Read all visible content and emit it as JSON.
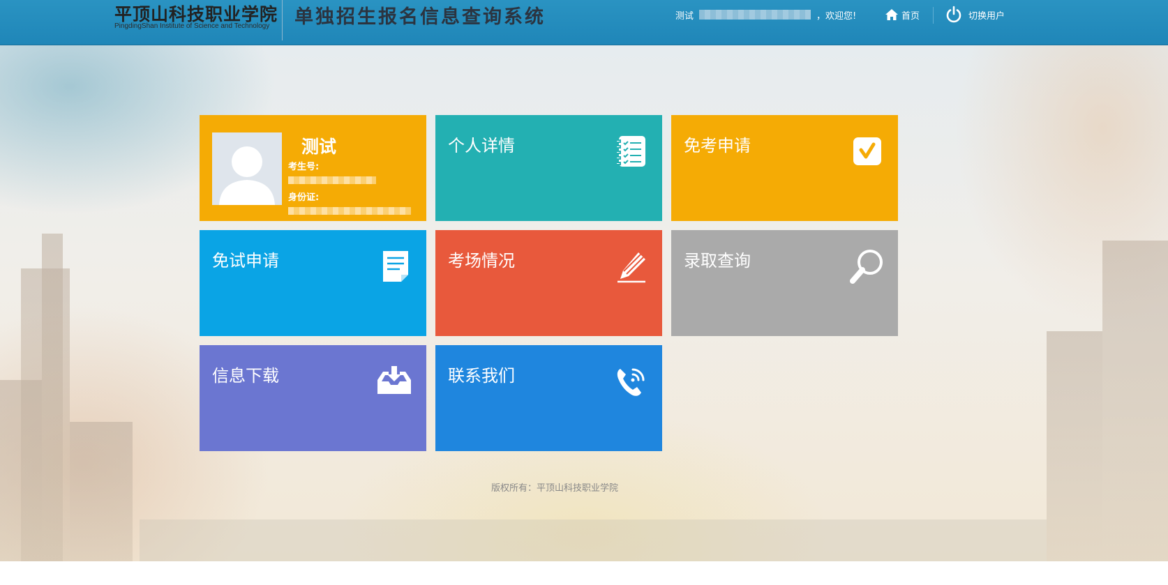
{
  "header": {
    "school_name_cn": "平顶山科技职业学院",
    "school_name_en": "PingdingShan Institute of Science and Technology",
    "system_title": "单独招生报名信息查询系统",
    "user_name": "测试",
    "welcome_suffix": "，欢迎您!",
    "home_label": "首页",
    "switch_user_label": "切换用户"
  },
  "profile_tile": {
    "name": "测试",
    "exam_number_label": "考生号:",
    "id_card_label": "身份证:"
  },
  "tiles": {
    "detail": "个人详情",
    "exempt_exam": "免考申请",
    "exempt_test": "免试申请",
    "exam_room": "考场情况",
    "admission": "录取查询",
    "download": "信息下载",
    "contact": "联系我们"
  },
  "footer": {
    "copyright": "版权所有：平顶山科技职业学院"
  },
  "colors": {
    "header_bg": "#2a93c2",
    "orange": "#f5ab05",
    "teal": "#23b0b2",
    "sky_blue": "#0aa4e5",
    "red_orange": "#e8593c",
    "gray": "#aaaaaa",
    "purple": "#6b76d1",
    "blue": "#1f86de"
  },
  "icons": {
    "home": "home-icon",
    "power": "power-icon",
    "detail": "checklist-icon",
    "exempt_exam": "checkmark-icon",
    "exempt_test": "document-icon",
    "exam_room": "pencil-icon",
    "admission": "magnifier-icon",
    "download": "inbox-download-icon",
    "contact": "phone-icon"
  }
}
